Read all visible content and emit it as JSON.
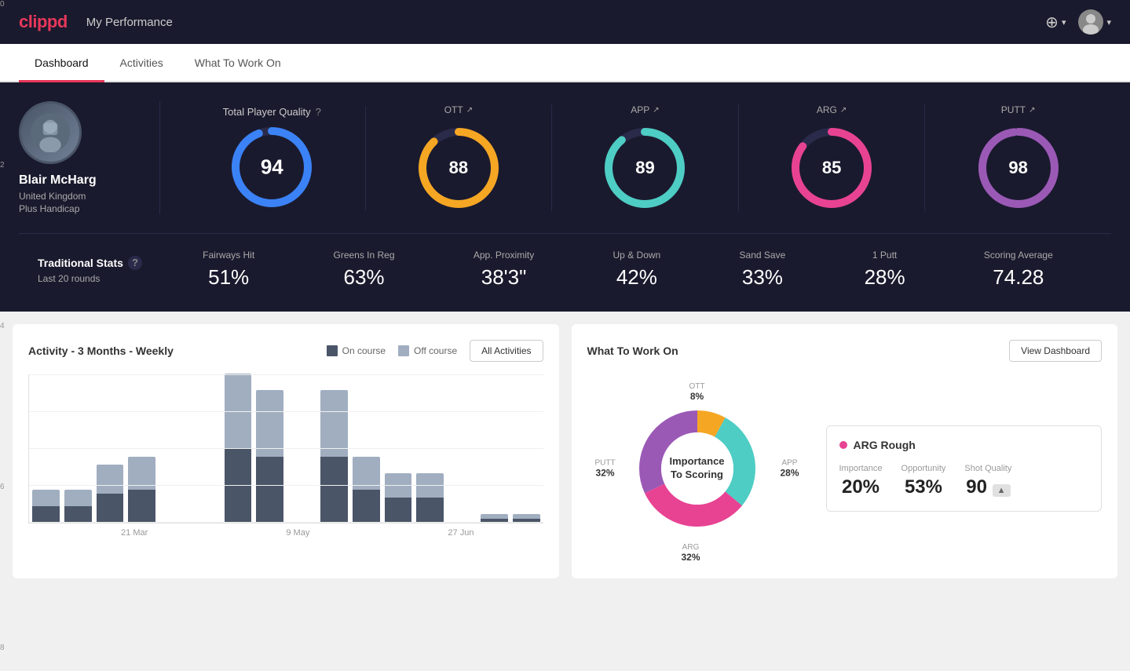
{
  "header": {
    "logo": "clippd",
    "title": "My Performance",
    "add_icon": "⊕",
    "chevron": "▾"
  },
  "nav": {
    "tabs": [
      {
        "label": "Dashboard",
        "active": true
      },
      {
        "label": "Activities",
        "active": false
      },
      {
        "label": "What To Work On",
        "active": false
      }
    ]
  },
  "player": {
    "name": "Blair McHarg",
    "country": "United Kingdom",
    "handicap": "Plus Handicap"
  },
  "scores": {
    "tpq_label": "Total Player Quality",
    "tpq_value": 94,
    "tpq_percent": 94,
    "ott": {
      "label": "OTT",
      "value": 88,
      "percent": 88,
      "color": "#f5a623"
    },
    "app": {
      "label": "APP",
      "value": 89,
      "percent": 89,
      "color": "#4ecdc4"
    },
    "arg": {
      "label": "ARG",
      "value": 85,
      "percent": 85,
      "color": "#e84393"
    },
    "putt": {
      "label": "PUTT",
      "value": 98,
      "percent": 98,
      "color": "#9b59b6"
    }
  },
  "traditional_stats": {
    "title": "Traditional Stats",
    "subtitle": "Last 20 rounds",
    "items": [
      {
        "label": "Fairways Hit",
        "value": "51%"
      },
      {
        "label": "Greens In Reg",
        "value": "63%"
      },
      {
        "label": "App. Proximity",
        "value": "38'3\""
      },
      {
        "label": "Up & Down",
        "value": "42%"
      },
      {
        "label": "Sand Save",
        "value": "33%"
      },
      {
        "label": "1 Putt",
        "value": "28%"
      },
      {
        "label": "Scoring Average",
        "value": "74.28"
      }
    ]
  },
  "activity_chart": {
    "title": "Activity - 3 Months - Weekly",
    "legend_on_course": "On course",
    "legend_off_course": "Off course",
    "button_label": "All Activities",
    "y_labels": [
      "0",
      "2",
      "4",
      "6",
      "8"
    ],
    "x_labels": [
      "21 Mar",
      "9 May",
      "27 Jun"
    ],
    "bars": [
      {
        "on": 1,
        "off": 1
      },
      {
        "on": 1.5,
        "off": 0.5
      },
      {
        "on": 2,
        "off": 1.5
      },
      {
        "on": 2,
        "off": 2
      },
      {
        "on": 0,
        "off": 0
      },
      {
        "on": 0,
        "off": 0
      },
      {
        "on": 4,
        "off": 5
      },
      {
        "on": 3,
        "off": 5
      },
      {
        "on": 0,
        "off": 0
      },
      {
        "on": 3.5,
        "off": 4.5
      },
      {
        "on": 3,
        "off": 1
      },
      {
        "on": 2,
        "off": 1
      },
      {
        "on": 1,
        "off": 2
      },
      {
        "on": 0,
        "off": 0
      },
      {
        "on": 0.5,
        "off": 0
      },
      {
        "on": 0.5,
        "off": 0
      }
    ],
    "max_value": 9
  },
  "what_to_work_on": {
    "title": "What To Work On",
    "button_label": "View Dashboard",
    "donut": {
      "center_line1": "Importance",
      "center_line2": "To Scoring",
      "segments": [
        {
          "label": "OTT",
          "value": 8,
          "color": "#f5a623",
          "percent": "8%"
        },
        {
          "label": "APP",
          "value": 28,
          "color": "#4ecdc4",
          "percent": "28%"
        },
        {
          "label": "ARG",
          "value": 32,
          "color": "#e84393",
          "percent": "32%"
        },
        {
          "label": "PUTT",
          "value": 32,
          "color": "#9b59b6",
          "percent": "32%"
        }
      ]
    },
    "detail": {
      "title": "ARG Rough",
      "dot_color": "#e84393",
      "metrics": [
        {
          "label": "Importance",
          "value": "20%"
        },
        {
          "label": "Opportunity",
          "value": "53%"
        },
        {
          "label": "Shot Quality",
          "value": "90",
          "badge": "▲"
        }
      ]
    }
  },
  "colors": {
    "tpq": "#3b82f6",
    "ott": "#f5a623",
    "app": "#4ecdc4",
    "arg": "#e84393",
    "putt": "#9b59b6",
    "on_course": "#4a5568",
    "off_course": "#a0aec0",
    "dark_bg": "#1a1a2e",
    "accent": "#e8375a"
  }
}
